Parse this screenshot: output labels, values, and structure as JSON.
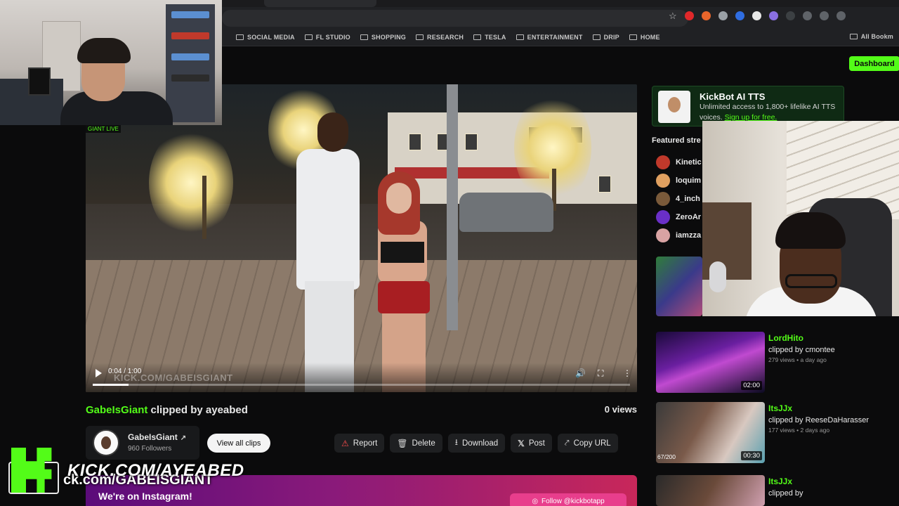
{
  "bookmarks": {
    "folders": [
      "SOCIAL MEDIA",
      "FL STUDIO",
      "SHOPPING",
      "RESEARCH",
      "TESLA",
      "ENTERTAINMENT",
      "DRIP",
      "HOME"
    ],
    "all_bookmarks": "All Bookm"
  },
  "header": {
    "dashboard_label": "Dashboard"
  },
  "video": {
    "time": "0:04 / 1:00",
    "watermark": "KICK.COM/GABEISGIANT",
    "progress": 0.067,
    "cam_tag": "GIANT LIVE"
  },
  "clip": {
    "channel": "GabeIsGiant",
    "clipped_by_text": "clipped by ayeabed",
    "views": "0 views"
  },
  "channel_card": {
    "name": "GabeIsGiant",
    "followers": "960 Followers",
    "view_all_label": "View all clips"
  },
  "actions": {
    "report": "Report",
    "delete": "Delete",
    "download": "Download",
    "post": "Post",
    "copy_url": "Copy URL"
  },
  "banner": {
    "text": "We're on Instagram!",
    "follow_label": "Follow @kickbotapp"
  },
  "overlays": {
    "line1": "KICK.COM/AYEABED",
    "line2": "ck.com/GABEISGIANT"
  },
  "kickbot": {
    "title": "KickBot AI TTS",
    "desc": "Unlimited access to 1,800+ lifelike AI TTS voices.",
    "cta": "Sign up for free."
  },
  "sidebar": {
    "featured_heading": "Featured stre",
    "streamers": [
      {
        "name": "Kinetic",
        "color": "#c0392b"
      },
      {
        "name": "loquim",
        "color": "#e0a060"
      },
      {
        "name": "4_inch",
        "color": "#7a5a3a"
      },
      {
        "name": "ZeroAr",
        "color": "#6a2fc7"
      },
      {
        "name": "iamzza",
        "color": "#d9a3a3"
      }
    ],
    "clips": [
      {
        "channel": "LordHito",
        "by": "clipped by cmontee",
        "meta": "279 views • a day ago",
        "duration": "02:00",
        "views_overlay": ""
      },
      {
        "channel": "ItsJJx",
        "by": "clipped by ReeseDaHarasser",
        "meta": "177 views • 2 days ago",
        "duration": "00:30",
        "views_overlay": "67/200"
      },
      {
        "channel": "ItsJJx",
        "by": "clipped by",
        "meta": "",
        "duration": "",
        "views_overlay": ""
      }
    ]
  },
  "colors": {
    "kick_green": "#53fc18",
    "background": "#0b0b0c"
  }
}
